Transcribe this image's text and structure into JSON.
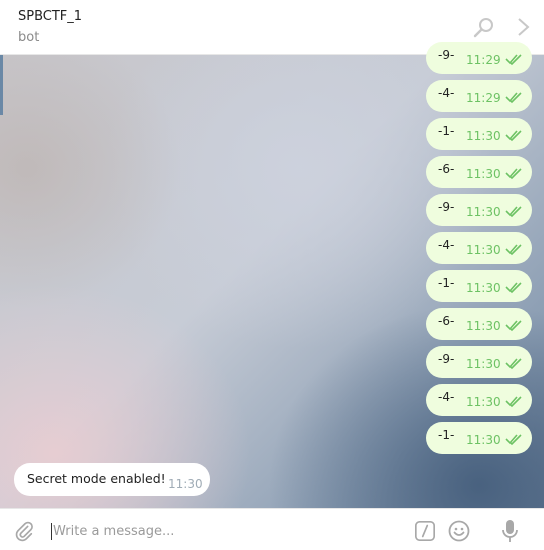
{
  "header": {
    "title": "SPBCTF_1",
    "subtitle": "bot",
    "icons": {
      "search": "search-icon",
      "next": "chevron-right-icon"
    }
  },
  "outgoing_messages": [
    {
      "text": "-9-",
      "time": "11:29"
    },
    {
      "text": "-4-",
      "time": "11:29"
    },
    {
      "text": "-1-",
      "time": "11:30"
    },
    {
      "text": "-6-",
      "time": "11:30"
    },
    {
      "text": "-9-",
      "time": "11:30"
    },
    {
      "text": "-4-",
      "time": "11:30"
    },
    {
      "text": "-1-",
      "time": "11:30"
    },
    {
      "text": "-6-",
      "time": "11:30"
    },
    {
      "text": "-9-",
      "time": "11:30"
    },
    {
      "text": "-4-",
      "time": "11:30"
    },
    {
      "text": "-1-",
      "time": "11:30"
    }
  ],
  "incoming_message": {
    "text": "Secret mode enabled!",
    "time": "11:30"
  },
  "composer": {
    "placeholder": "Write a message...",
    "value": "",
    "icons": {
      "attach": "paperclip-icon",
      "commands": "slash-command-icon",
      "emoji": "emoji-icon",
      "voice": "microphone-icon"
    }
  },
  "colors": {
    "outgoing_bubble": "#effdde",
    "outgoing_time": "#6dc264",
    "incoming_bubble": "#ffffff",
    "header_icon": "#c8c8c8"
  }
}
